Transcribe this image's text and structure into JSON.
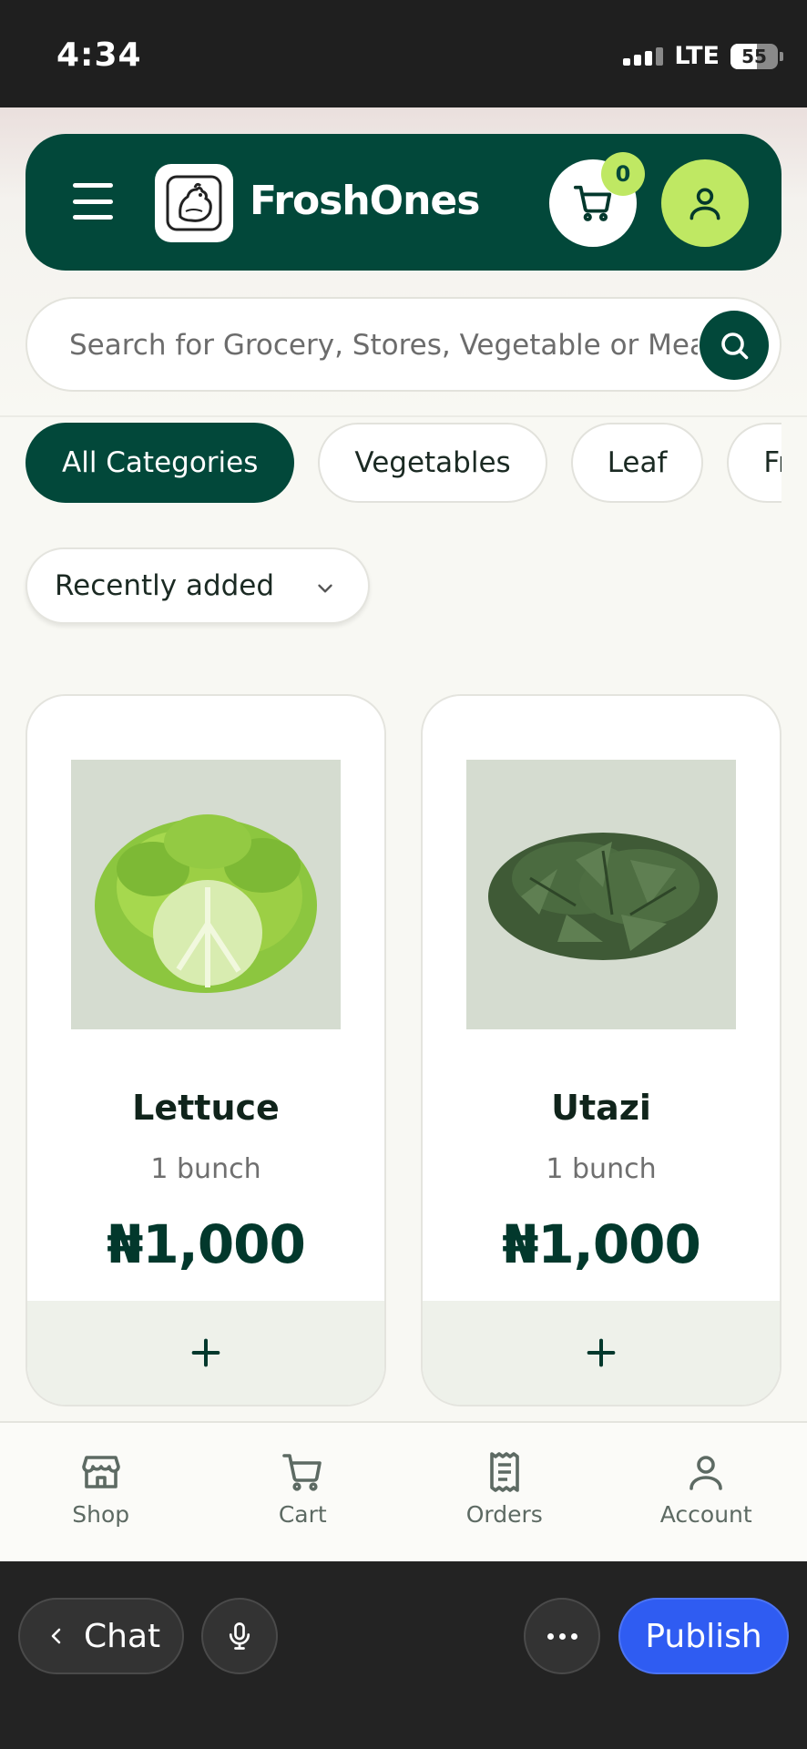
{
  "status_bar": {
    "time": "4:34",
    "network": "LTE",
    "battery": "55"
  },
  "header": {
    "menu_icon": "hamburger-menu-icon",
    "logo_icon": "chicken-logo-icon",
    "brand": "FroshOnes",
    "cart_icon": "cart-icon",
    "cart_count": "0",
    "account_icon": "user-icon"
  },
  "search": {
    "placeholder": "Search for Grocery, Stores, Vegetable or Meat",
    "button_icon": "search-icon"
  },
  "categories": [
    {
      "label": "All Categories",
      "active": true
    },
    {
      "label": "Vegetables",
      "active": false
    },
    {
      "label": "Leaf",
      "active": false
    },
    {
      "label": "Fr",
      "active": false
    }
  ],
  "sort": {
    "label": "Recently added",
    "icon": "chevron-down-icon"
  },
  "products": [
    {
      "name": "Lettuce",
      "unit": "1 bunch",
      "price": "₦1,000",
      "add_icon": "plus-icon"
    },
    {
      "name": "Utazi",
      "unit": "1 bunch",
      "price": "₦1,000",
      "add_icon": "plus-icon"
    }
  ],
  "bottom_nav": [
    {
      "label": "Shop",
      "icon": "shop-icon"
    },
    {
      "label": "Cart",
      "icon": "cart-icon"
    },
    {
      "label": "Orders",
      "icon": "receipt-icon"
    },
    {
      "label": "Account",
      "icon": "user-icon"
    }
  ],
  "toolbar": {
    "chat_label": "Chat",
    "publish_label": "Publish"
  },
  "colors": {
    "brand_green": "#02483a",
    "accent_lime": "#bfe863",
    "publish_blue": "#2f5cf2"
  }
}
